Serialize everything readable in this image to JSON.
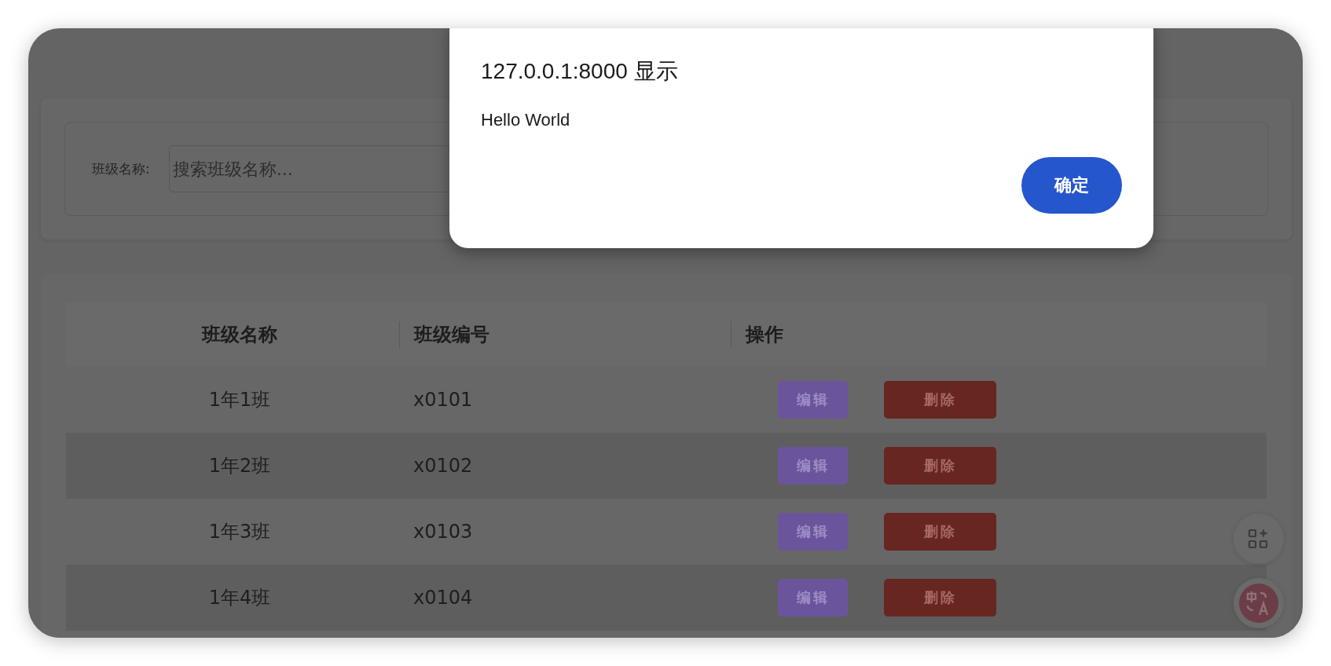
{
  "dialog": {
    "title": "127.0.0.1:8000 显示",
    "message": "Hello World",
    "button": "确定"
  },
  "search": {
    "label": "班级名称:",
    "placeholder": "搜索班级名称..."
  },
  "table": {
    "columns": [
      "班级名称",
      "班级编号",
      "操作"
    ],
    "rows": [
      {
        "name": "1年1班",
        "code": "x0101",
        "actions": [
          {
            "label": "编辑",
            "kind": "edit"
          },
          {
            "label": "删除",
            "kind": "delete"
          }
        ]
      },
      {
        "name": "1年2班",
        "code": "x0102",
        "actions": [
          {
            "label": "编辑",
            "kind": "edit"
          },
          {
            "label": "删除",
            "kind": "delete"
          }
        ]
      },
      {
        "name": "1年3班",
        "code": "x0103",
        "actions": [
          {
            "label": "编辑",
            "kind": "edit"
          },
          {
            "label": "删除",
            "kind": "delete"
          }
        ]
      },
      {
        "name": "1年4班",
        "code": "x0104",
        "actions": [
          {
            "label": "编辑",
            "kind": "edit"
          },
          {
            "label": "删除",
            "kind": "delete"
          }
        ]
      }
    ]
  }
}
